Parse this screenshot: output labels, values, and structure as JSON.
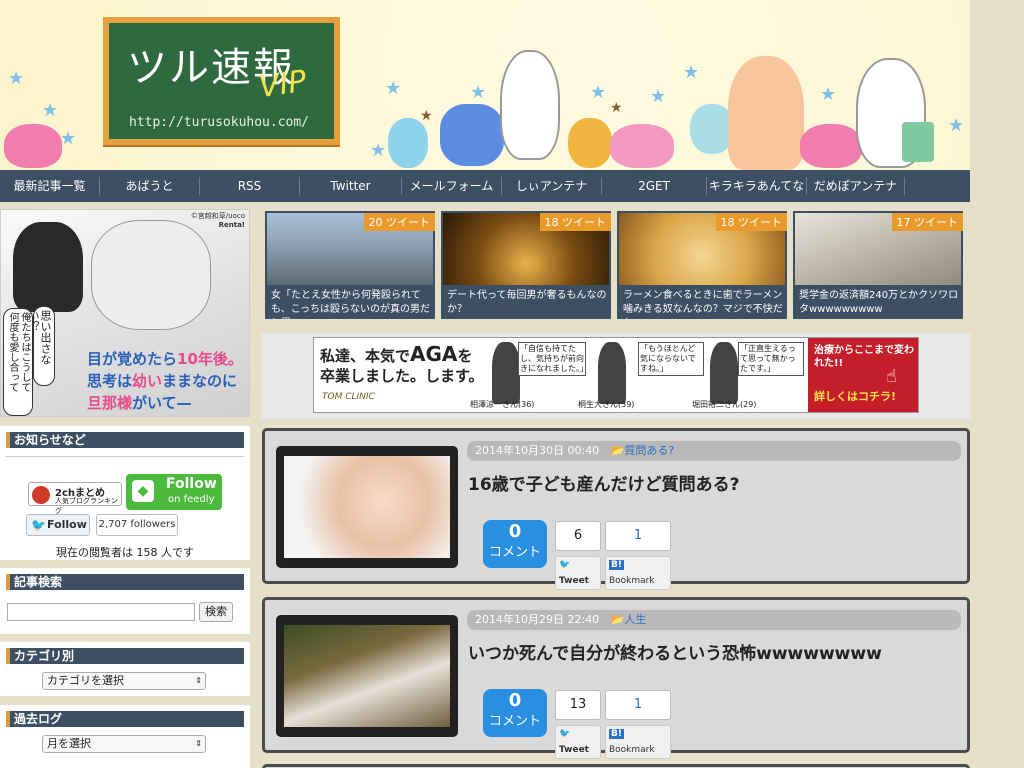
{
  "header": {
    "title": "ツル速報",
    "title_vip": "VIP",
    "url": "http://turusokuhou.com/"
  },
  "nav": {
    "items": [
      "最新記事一覧",
      "あばうと",
      "RSS",
      "Twitter",
      "メールフォーム",
      "しぃアンテナ",
      "2GET",
      "キラキラあんてな",
      "だめぽアンテナ"
    ]
  },
  "left_ad": {
    "speech": "思い出さない？",
    "speech2": "俺たちはこうして\n何度も愛し合って",
    "caption_line1_a": "目が覚めたら",
    "caption_line1_b": "10年後。",
    "caption_line2_a": "思考は",
    "caption_line2_b": "幼い",
    "caption_line2_c": "ままなのに",
    "caption_line3_a": "旦那様",
    "caption_line3_b": "がいて",
    "credit": "©宮越和草/uoco",
    "credit2": "Renta!"
  },
  "notice": {
    "heading": "お知らせなど",
    "badge_2ch_top": "2chまとめ",
    "badge_2ch_bottom": "人気ブログランキング",
    "follow_feedly": "Follow",
    "follow_feedly_sub": "on feedly",
    "twitter_follow": "Follow",
    "followers": "2,707 followers",
    "viewers_text": "現在の閲覧者は 158 人です"
  },
  "search": {
    "heading": "記事検索",
    "button": "検索",
    "placeholder": ""
  },
  "category": {
    "heading": "カテゴリ別",
    "selected": "カテゴリを選択"
  },
  "archive": {
    "heading": "過去ログ",
    "selected": "月を選択"
  },
  "trending": [
    {
      "tweets": "20 ツイート",
      "text": "女「たとえ女性から何発殴られても、こっちは殴らないのが真の男だと思"
    },
    {
      "tweets": "18 ツイート",
      "text": "デート代って毎回男が奢るもんなのか？"
    },
    {
      "tweets": "18 ツイート",
      "text": "ラーメン食べるときに歯でラーメン噛みきる奴なんなの？マジで不快だか"
    },
    {
      "tweets": "17 ツイート",
      "text": "奨学金の返済額240万とかクソワロタwwwwwwwww"
    }
  ],
  "banner": {
    "headline1": "私達、本気で",
    "headline_aga": "AGA",
    "headline2": "を",
    "headline3": "卒業しました。します。",
    "clinic": "TOM CLINIC",
    "quote1": "「自信も持てたし、気持ちが前向きになれました。」",
    "quote2": "「もうほとんど気にならないですね。」",
    "quote3": "「正直生えるって思って無かったです。」",
    "person1": "相澤涼一さん(36)",
    "person2": "桐生大さん(39)",
    "person3": "堀田裕二さん(29)",
    "cta_top": "治療からここまで変われた!!",
    "cta_bottom": "詳しくはコチラ!"
  },
  "articles": [
    {
      "date": "2014年10月30日 00:40",
      "category": "質問ある?",
      "title": "16歳で子ども産んだけど質問ある?",
      "comments": "0",
      "comment_label": "コメント",
      "tweet_count": "6",
      "tweet_label": "Tweet",
      "bookmark_count": "1",
      "bookmark_label": "Bookmark"
    },
    {
      "date": "2014年10月29日 22:40",
      "category": "人生",
      "title": "いつか死んで自分が終わるという恐怖wwwwwwww",
      "comments": "0",
      "comment_label": "コメント",
      "tweet_count": "13",
      "tweet_label": "Tweet",
      "bookmark_count": "1",
      "bookmark_label": "Bookmark"
    }
  ],
  "colors": {
    "nav_bg": "#3d4f63",
    "accent_orange": "#e89a2b",
    "comment_blue": "#2a8fe0",
    "chalkboard_green": "#2e6a3d"
  }
}
